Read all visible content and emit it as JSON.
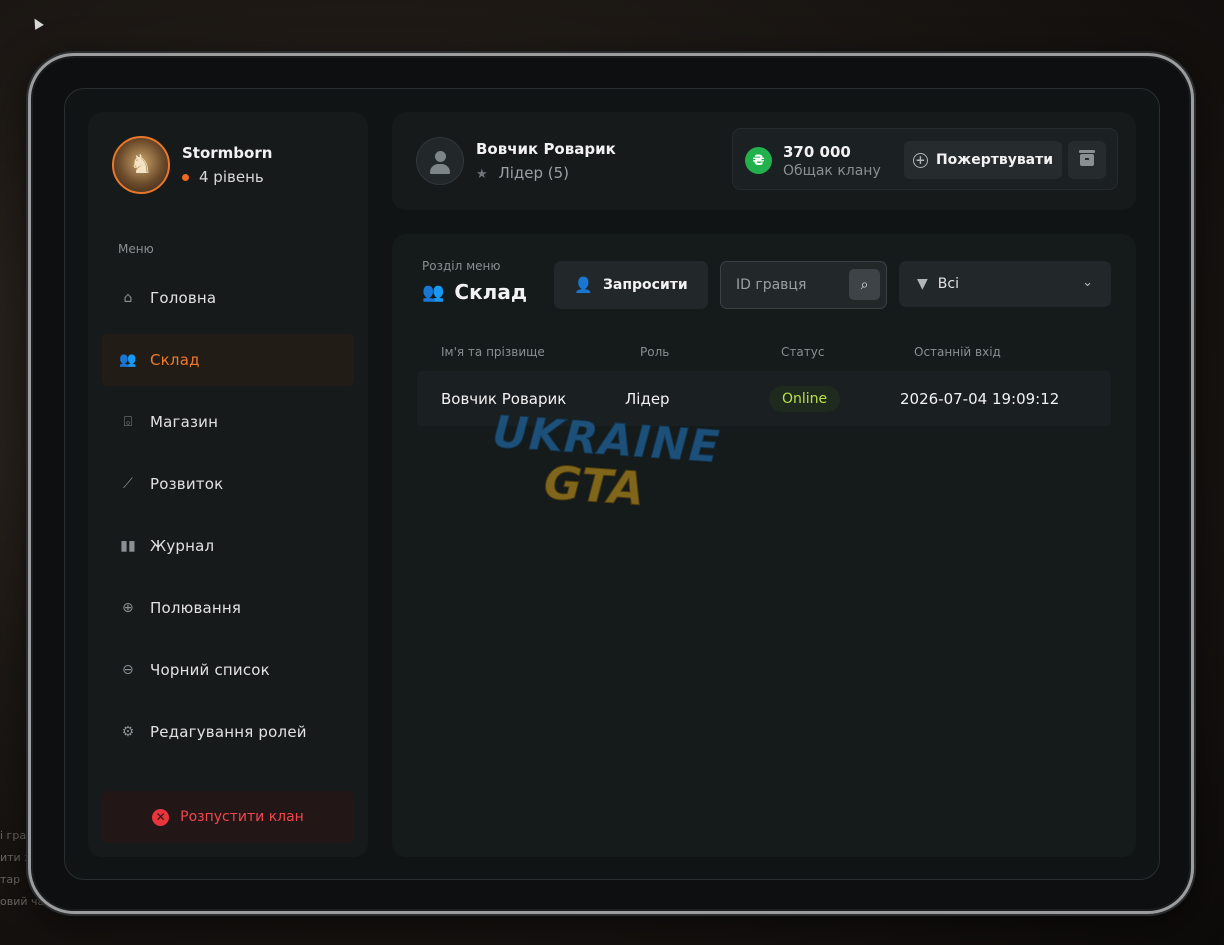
{
  "background": {
    "chat_lines": [
      "і грав",
      "ити з",
      "тар",
      "овий чат"
    ]
  },
  "sidebar": {
    "profile": {
      "name": "Stormborn",
      "level": "4 рівень"
    },
    "menu_caption": "Меню",
    "items": [
      {
        "label": "Головна",
        "icon": "home-icon"
      },
      {
        "label": "Склад",
        "icon": "users-icon",
        "active": true
      },
      {
        "label": "Магазин",
        "icon": "basket-icon"
      },
      {
        "label": "Розвиток",
        "icon": "chart-line-icon"
      },
      {
        "label": "Журнал",
        "icon": "book-icon"
      },
      {
        "label": "Полювання",
        "icon": "crosshair-icon"
      },
      {
        "label": "Чорний список",
        "icon": "minus-circle-icon"
      },
      {
        "label": "Редагування ролей",
        "icon": "user-gear-icon"
      }
    ],
    "disband_label": "Розпустити клан"
  },
  "header": {
    "user_name": "Вовчик Роварик",
    "user_role": "Лідер (5)",
    "bank": {
      "currency_symbol": "₴",
      "amount": "370 000",
      "label": "Общак клану"
    },
    "donate_label": "Пожертвувати"
  },
  "main": {
    "section_caption": "Розділ меню",
    "section_title": "Склад",
    "invite_label": "Запросити",
    "search_placeholder": "ID гравця",
    "filter_value": "Всі",
    "table": {
      "columns": [
        "Ім'я та прізвище",
        "Роль",
        "Статус",
        "Останній вхід"
      ],
      "rows": [
        {
          "name": "Вовчик Роварик",
          "role": "Лідер",
          "status": "Online",
          "last_login": "2026-07-04 19:09:12"
        }
      ]
    }
  },
  "watermark": {
    "line1": "UKRAINE",
    "line2": "GTA"
  },
  "colors": {
    "accent": "#f07a2c",
    "danger": "#f0474d",
    "online": "#b8e04a",
    "currency": "#22b14c"
  }
}
